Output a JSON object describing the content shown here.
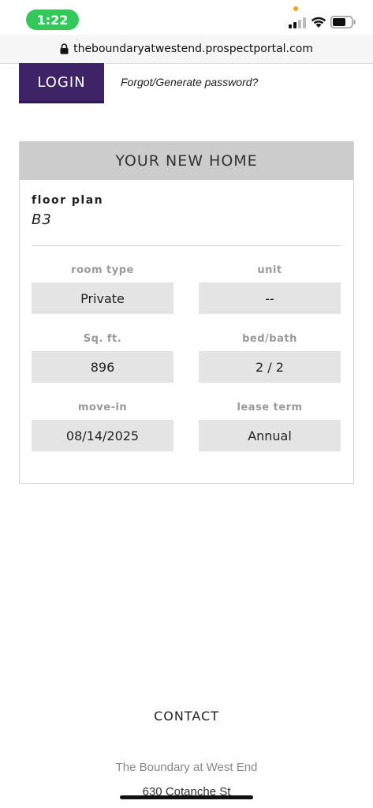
{
  "status_bar": {
    "time": "1:22"
  },
  "browser": {
    "url": "theboundaryatwestend.prospectportal.com"
  },
  "login": {
    "button_label": "LOGIN",
    "forgot_label": "Forgot/Generate password?"
  },
  "card": {
    "title": "YOUR NEW HOME",
    "floor_plan_label": "floor plan",
    "floor_plan_value": "B3",
    "fields": [
      {
        "label": "room type",
        "value": "Private"
      },
      {
        "label": "unit",
        "value": "--"
      },
      {
        "label": "Sq. ft.",
        "value": "896"
      },
      {
        "label": "bed/bath",
        "value": "2 / 2"
      },
      {
        "label": "move-in",
        "value": "08/14/2025"
      },
      {
        "label": "lease term",
        "value": "Annual"
      }
    ]
  },
  "footer": {
    "contact_heading": "CONTACT",
    "property_name": "The Boundary at West End",
    "street": "630 Cotanche St"
  },
  "colors": {
    "accent": "#3e2466",
    "status_green": "#34c759",
    "header_gray": "#cccccc",
    "field_gray": "#e4e4e4"
  }
}
